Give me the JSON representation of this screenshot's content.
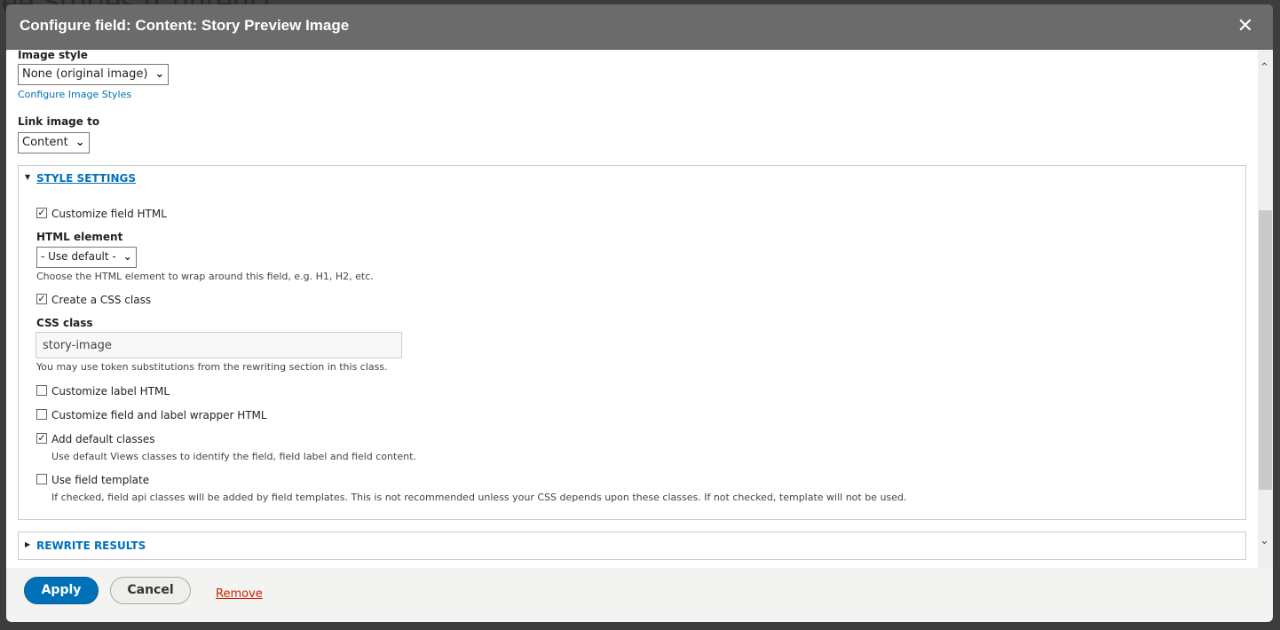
{
  "background": {
    "page_title": "ree Stories (Content)"
  },
  "dialog": {
    "title": "Configure field: Content: Story Preview Image",
    "close_label": "✕"
  },
  "form": {
    "image_style": {
      "label": "Image style",
      "value": "None (original image)",
      "link": "Configure Image Styles"
    },
    "link_image_to": {
      "label": "Link image to",
      "value": "Content"
    },
    "style_settings": {
      "summary": "STYLE SETTINGS",
      "expanded": true,
      "customize_field_html": {
        "label": "Customize field HTML",
        "checked": true
      },
      "html_element": {
        "label": "HTML element",
        "value": "- Use default -",
        "description": "Choose the HTML element to wrap around this field, e.g. H1, H2, etc."
      },
      "create_css_class": {
        "label": "Create a CSS class",
        "checked": true
      },
      "css_class": {
        "label": "CSS class",
        "value": "story-image",
        "description": "You may use token substitutions from the rewriting section in this class."
      },
      "customize_label_html": {
        "label": "Customize label HTML",
        "checked": false
      },
      "customize_wrapper_html": {
        "label": "Customize field and label wrapper HTML",
        "checked": false
      },
      "add_default_classes": {
        "label": "Add default classes",
        "checked": true,
        "description": "Use default Views classes to identify the field, field label and field content."
      },
      "use_field_template": {
        "label": "Use field template",
        "checked": false,
        "description": "If checked, field api classes will be added by field templates. This is not recommended unless your CSS depends upon these classes. If not checked, template will not be used."
      }
    },
    "rewrite_results": {
      "summary": "REWRITE RESULTS",
      "expanded": false
    }
  },
  "footer": {
    "apply": "Apply",
    "cancel": "Cancel",
    "remove": "Remove"
  },
  "colors": {
    "accent": "#0071b8",
    "remove": "#cc2200",
    "header": "#6b6b6b"
  }
}
